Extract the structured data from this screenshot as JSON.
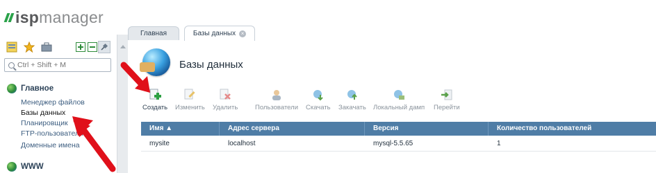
{
  "logo": {
    "part1": "isp",
    "part2": "manager"
  },
  "search": {
    "placeholder": "Ctrl + Shift + M"
  },
  "sidebar": {
    "section_main": "Главное",
    "items": [
      "Менеджер файлов",
      "Базы данных",
      "Планировщик",
      "FTP-пользователи",
      "Доменные имена"
    ],
    "section_www": "WWW"
  },
  "tabs": [
    {
      "label": "Главная"
    },
    {
      "label": "Базы данных"
    }
  ],
  "page": {
    "title": "Базы данных"
  },
  "toolbar": [
    {
      "label": "Создать"
    },
    {
      "label": "Изменить"
    },
    {
      "label": "Удалить"
    },
    {
      "label": "Пользователи"
    },
    {
      "label": "Скачать"
    },
    {
      "label": "Закачать"
    },
    {
      "label": "Локальный дамп"
    },
    {
      "label": "Перейти"
    }
  ],
  "table": {
    "columns": [
      "Имя ▲",
      "Адрес сервера",
      "Версия",
      "Количество пользователей"
    ],
    "rows": [
      [
        "mysite",
        "localhost",
        "mysql-5.5.65",
        "1"
      ]
    ]
  },
  "colors": {
    "accent": "#4f7da6",
    "logo_green": "#2aa24a",
    "arrow_red": "#e0101a"
  }
}
